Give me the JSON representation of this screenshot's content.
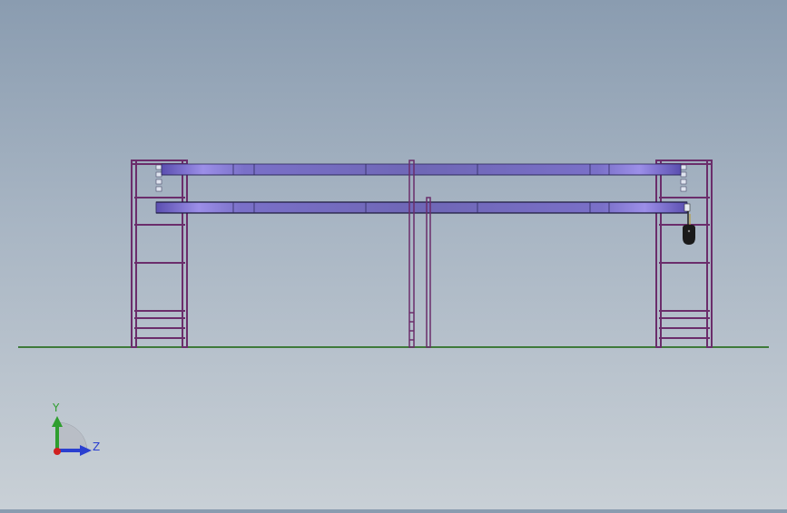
{
  "view": {
    "background_top": "#8a9cb0",
    "background_bottom": "#c9d0d6",
    "ground_color": "#3f7a3a",
    "frame_color": "#6b2d6b",
    "beam_color": "#7a70c8",
    "beam_highlight": "#9c8fe8",
    "hook_color": "#1a1a1a"
  },
  "triad": {
    "y_label": "Y",
    "z_label": "Z",
    "y_color": "#2e9e2e",
    "z_color": "#2a3fd0",
    "x_color": "#d02020"
  }
}
